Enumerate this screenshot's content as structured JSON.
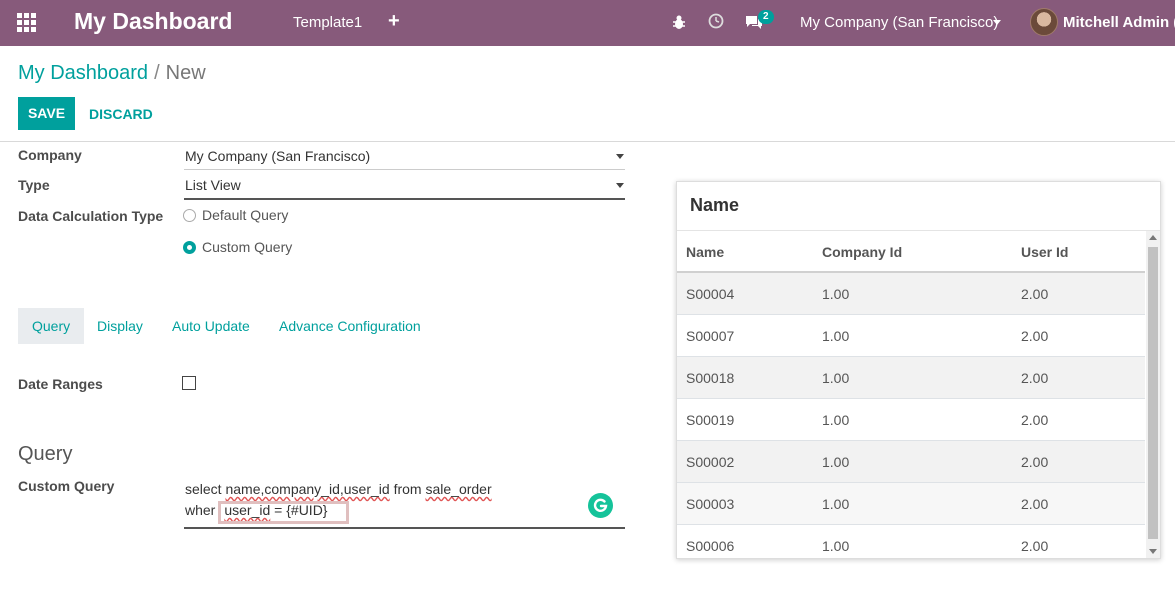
{
  "navbar": {
    "brand": "My Dashboard",
    "tab": "Template1",
    "plus": "+",
    "chat_count": "2",
    "company": "My Company (San Francisco)",
    "user": "Mitchell Admin (o"
  },
  "breadcrumb": {
    "parent": "My Dashboard",
    "separator": "/",
    "current": "New"
  },
  "buttons": {
    "save": "SAVE",
    "discard": "DISCARD"
  },
  "form": {
    "company_label": "Company",
    "company_value": "My Company (San Francisco)",
    "type_label": "Type",
    "type_value": "List View",
    "calc_label": "Data Calculation Type",
    "calc_options": [
      "Default Query",
      "Custom Query"
    ],
    "calc_selected": "Custom Query",
    "tabs": [
      "Query",
      "Display",
      "Auto Update",
      "Advance Configuration"
    ],
    "date_ranges_label": "Date Ranges",
    "section_title": "Query",
    "custom_query_label": "Custom Query",
    "query_line1_a": "select ",
    "query_line1_b": "name,company_id,user_id",
    "query_line1_c": " from ",
    "query_line1_d": "sale_order",
    "query_line2_a": "wher",
    "query_line2_b": "user_id",
    "query_line2_c": " = {#UID}"
  },
  "preview": {
    "title": "Name",
    "columns": [
      "Name",
      "Company Id",
      "User Id"
    ],
    "rows": [
      [
        "S00004",
        "1.00",
        "2.00"
      ],
      [
        "S00007",
        "1.00",
        "2.00"
      ],
      [
        "S00018",
        "1.00",
        "2.00"
      ],
      [
        "S00019",
        "1.00",
        "2.00"
      ],
      [
        "S00002",
        "1.00",
        "2.00"
      ],
      [
        "S00003",
        "1.00",
        "2.00"
      ],
      [
        "S00006",
        "1.00",
        "2.00"
      ]
    ]
  },
  "icons": {
    "apps": "apps-grid-icon",
    "bug": "bug-icon",
    "clock": "clock-icon",
    "chat": "chat-icon",
    "grammarly": "grammarly-icon"
  },
  "colors": {
    "navbar": "#875A7B",
    "accent": "#00A09D"
  }
}
